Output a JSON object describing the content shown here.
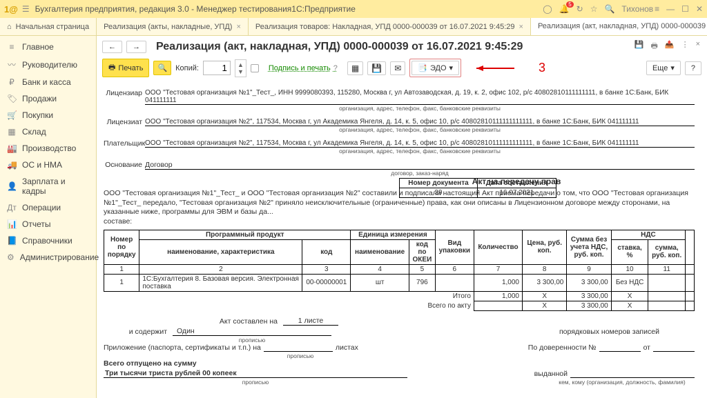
{
  "titlebar": {
    "logo": "1@",
    "title": "Бухгалтерия предприятия, редакция 3.0  - Менеджер тестирования1С:Предприятие",
    "bell_count": "5",
    "user": "Тихонов"
  },
  "home_tab": "Начальная страница",
  "tabs": [
    {
      "label": "Реализация (акты, накладные, УПД)",
      "active": false
    },
    {
      "label": "Реализация товаров: Накладная, УПД 0000-000039 от 16.07.2021 9:45:29",
      "active": false
    },
    {
      "label": "Реализация (акт, накладная, УПД) 0000-000039 от 16.07.2021 9:45:29",
      "active": true
    }
  ],
  "sidebar": {
    "items": [
      {
        "icon": "≡",
        "label": "Главное"
      },
      {
        "icon": "〰",
        "label": "Руководителю"
      },
      {
        "icon": "₽",
        "label": "Банк и касса"
      },
      {
        "icon": "🏷",
        "label": "Продажи"
      },
      {
        "icon": "🛒",
        "label": "Покупки"
      },
      {
        "icon": "▦",
        "label": "Склад"
      },
      {
        "icon": "🏭",
        "label": "Производство"
      },
      {
        "icon": "🚚",
        "label": "ОС и НМА"
      },
      {
        "icon": "👤",
        "label": "Зарплата и кадры"
      },
      {
        "icon": "Дт",
        "label": "Операции"
      },
      {
        "icon": "📊",
        "label": "Отчеты"
      },
      {
        "icon": "📘",
        "label": "Справочники"
      },
      {
        "icon": "⚙",
        "label": "Администрирование"
      }
    ]
  },
  "header": {
    "title": "Реализация (акт, накладная, УПД) 0000-000039 от 16.07.2021 9:45:29"
  },
  "toolbar": {
    "print": "Печать",
    "copies": "Копий:",
    "copies_value": "1",
    "sign_print": "Подпись и печать",
    "edo": "ЭДО",
    "more": "Еще",
    "help": "?"
  },
  "annotation_num": "3",
  "doc": {
    "licensor_label": "Лицензиар",
    "licensor": "ООО \"Тестовая организация №1\"_Тест_, ИНН 9999080393, 115280, Москва г, ул Автозаводская, д. 19, к. 2, офис 102, р/с 40802810111111111, в банке 1С:Банк, БИК 041111111",
    "sub_org": "организация, адрес, телефон, факс, банковские реквизиты",
    "licensee_label": "Лицензиат",
    "licensee": "ООО \"Тестовая организация №2\", 117534, Москва г, ул Академика Янгеля, д. 14, к. 5, офис 10, р/с 40802810111111111111, в банке 1С:Банк, БИК 041111111",
    "payer_label": "Плательщик",
    "payer": "ООО \"Тестовая организация №2\", 117534, Москва г, ул Академика Янгеля, д. 14, к. 5, офис 10, р/с 40802810111111111111, в банке 1С:Банк, БИК 041111111",
    "basis_label": "Основание",
    "basis": "Договор",
    "sub_basis": "договор, заказ-наряд",
    "act_title": "Акт на передачу прав",
    "dn_header_num": "Номер документа",
    "dn_header_date": "Дата составления",
    "dn_num": "39",
    "dn_date": "16.07.2021",
    "paragraph": "ООО \"Тестовая организация №1\"_Тест_ и ООО \"Тестовая организация №2\" составили и подписали настоящий Акт приема-передачи о том, что ООО \"Тестовая организация №1\"_Тест_ передало, \"Тестовая организация №2\" приняло неисключительные (ограниченные) права, как они описаны в Лицензионном договоре между сторонами, на указанные ниже, программы для ЭВМ и базы да...",
    "paragraph_suffix": "составе:",
    "col_headers": {
      "num": "Номер по порядку",
      "prod": "Программный продукт",
      "name": "наименование, характеристика",
      "code": "код",
      "unit": "Единица измерения",
      "unit_name": "наименование",
      "okei": "код по ОКЕИ",
      "pack": "Вид упаковки",
      "qty": "Количество",
      "price": "Цена, руб. коп.",
      "sum_no_vat": "Сумма без учета НДС, руб. коп.",
      "vat": "НДС",
      "vat_rate": "ставка, %",
      "vat_sum": "сумма, руб. коп."
    },
    "col_nums": [
      "1",
      "2",
      "3",
      "4",
      "5",
      "6",
      "7",
      "8",
      "9",
      "10",
      "11"
    ],
    "row": {
      "num": "1",
      "name": "1С:Бухгалтерия 8. Базовая версия. Электронная поставка",
      "code": "00-00000001",
      "unit": "шт",
      "okei": "796",
      "pack": "",
      "qty": "1,000",
      "price": "3 300,00",
      "sum": "3 300,00",
      "vat_rate": "Без НДС",
      "vat_sum": ""
    },
    "total_label": "Итого",
    "total_qty": "1,000",
    "total_x": "Х",
    "total_sum": "3 300,00",
    "grand_label": "Всего по акту",
    "grand_sum": "3 300,00",
    "composed": "Акт составлен на",
    "sheets_val": "1 листе",
    "contains": "и содержит",
    "contains_val": "Один",
    "contains_suffix": "порядковых номеров записей",
    "propisyu": "прописью",
    "attachment": "Приложение (паспорта, сертификаты и т.п.) на",
    "attachment_unit": "листах",
    "by_proxy": "По доверенности №",
    "from": "от",
    "total_released": "Всего отпущено  на сумму",
    "total_words": "Три тысячи триста рублей 00 копеек",
    "issued_by": "выданной",
    "footer_hint": "кем, кому (организация, должность, фамилия)"
  }
}
